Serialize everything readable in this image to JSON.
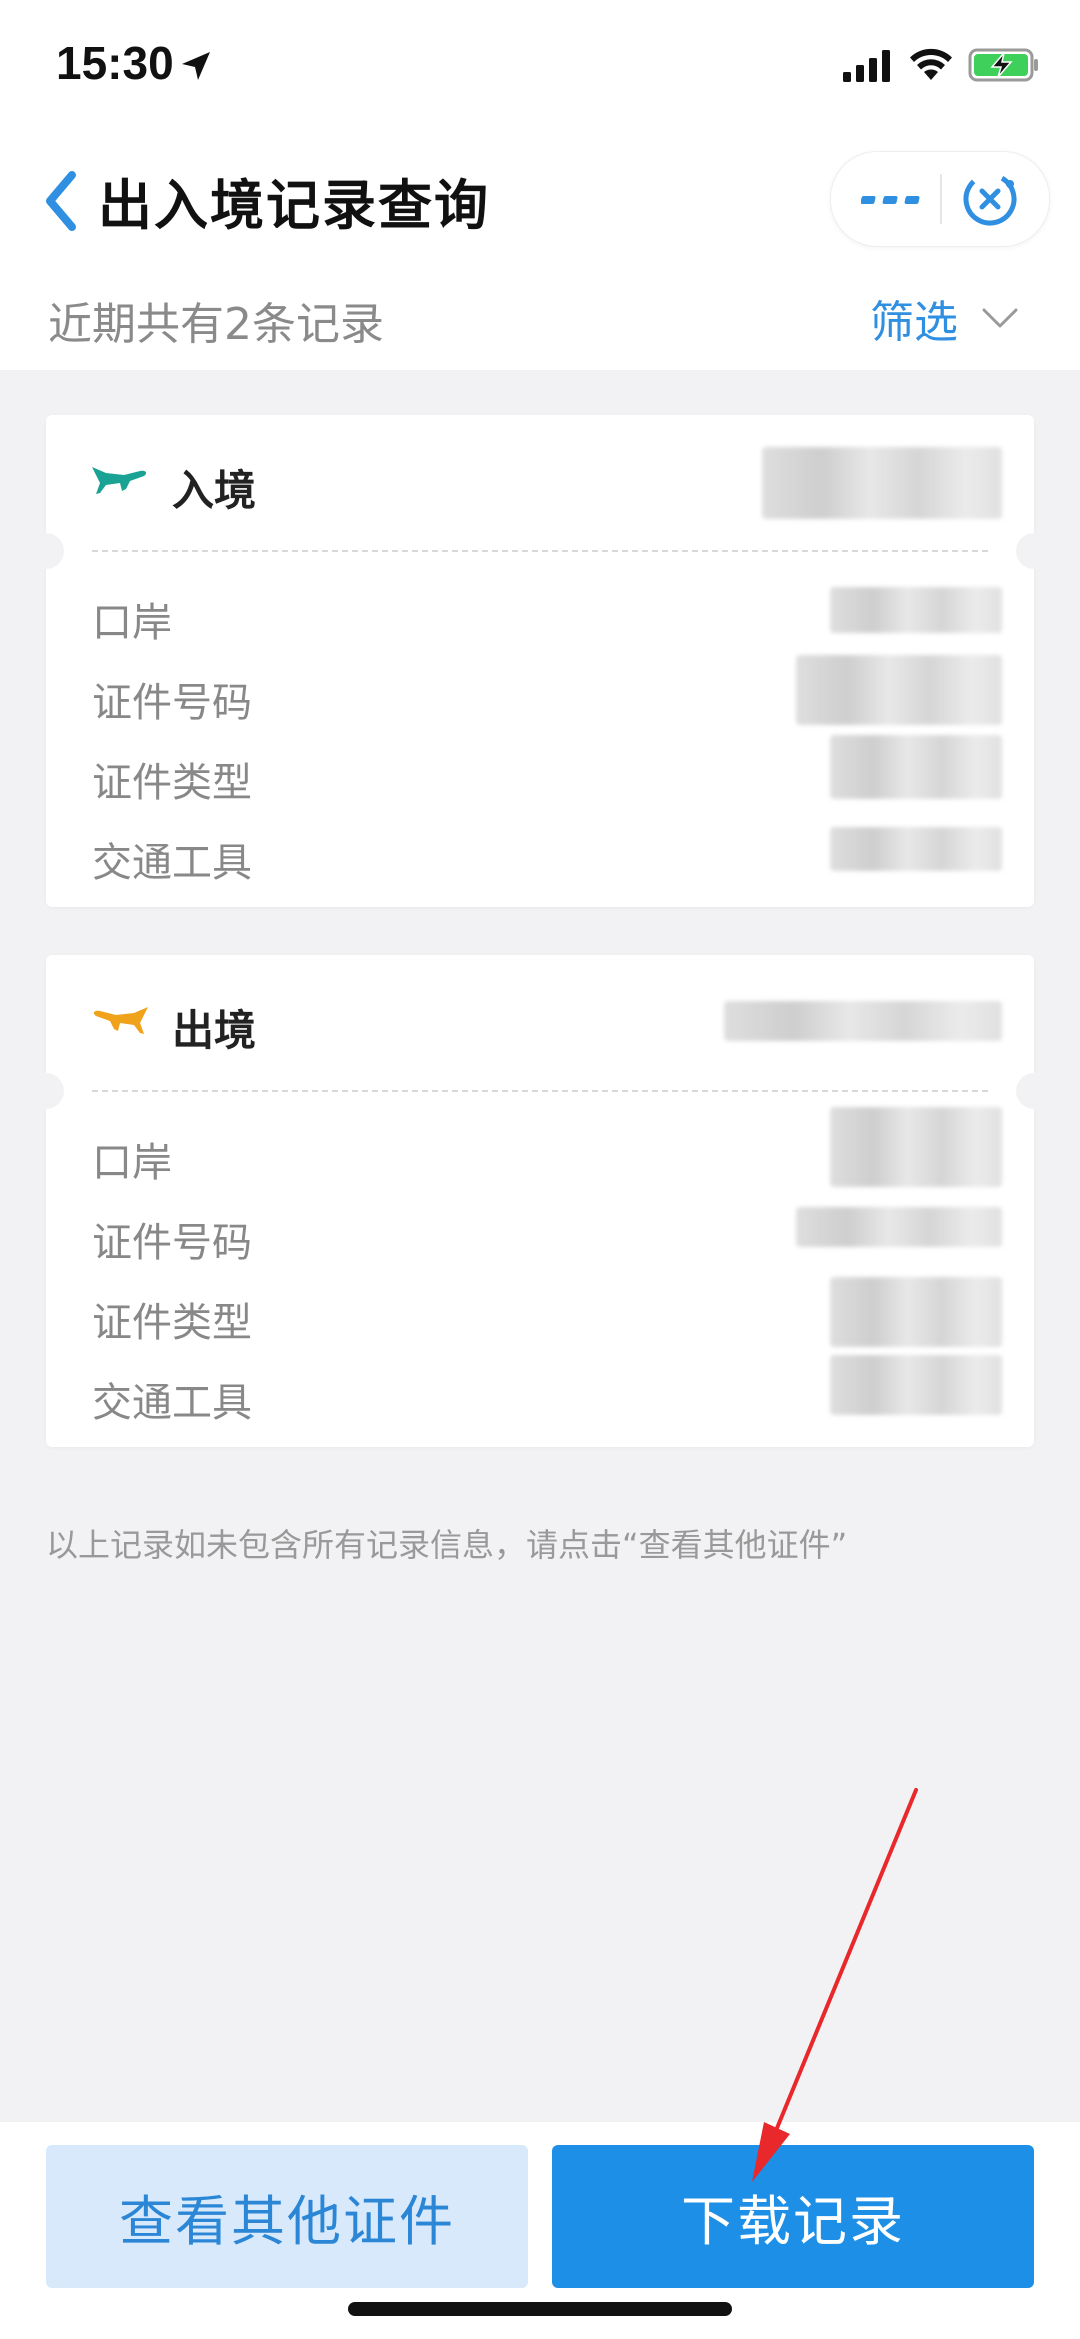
{
  "status_bar": {
    "time": "15:30"
  },
  "nav": {
    "title": "出入境记录查询"
  },
  "summary": {
    "text": "近期共有2条记录",
    "filter_label": "筛选"
  },
  "records": [
    {
      "type": "入境",
      "icon": "plane-arrival-icon",
      "icon_color": "#1aa394",
      "fields": [
        "口岸",
        "证件号码",
        "证件类型",
        "交通工具"
      ]
    },
    {
      "type": "出境",
      "icon": "plane-departure-icon",
      "icon_color": "#f0a21a",
      "fields": [
        "口岸",
        "证件号码",
        "证件类型",
        "交通工具"
      ]
    }
  ],
  "note": "以上记录如未包含所有记录信息，请点击“查看其他证件”",
  "buttons": {
    "secondary": "查看其他证件",
    "primary": "下载记录"
  },
  "colors": {
    "accent": "#1e8fe6",
    "annotation": "#e8282b"
  }
}
